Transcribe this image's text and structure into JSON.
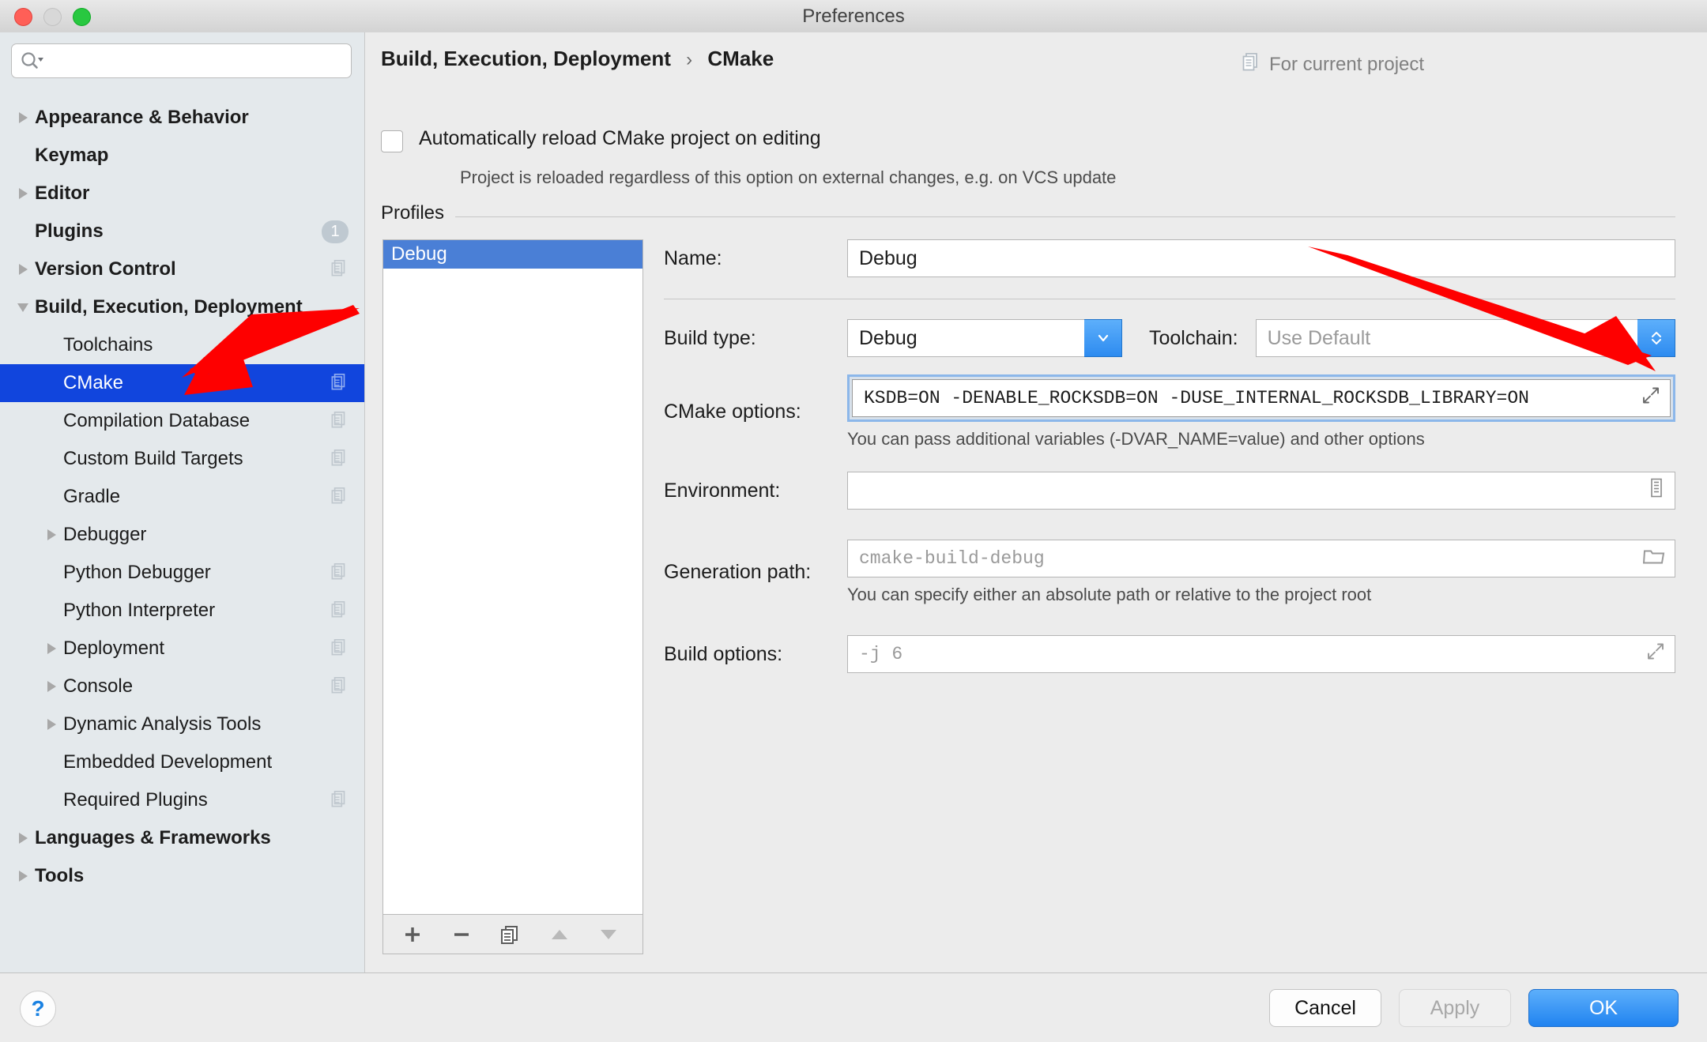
{
  "window": {
    "title": "Preferences"
  },
  "search": {
    "placeholder": "",
    "icon": "search-icon"
  },
  "sidebar": {
    "items": [
      {
        "label": "Appearance & Behavior",
        "level": 0,
        "twisty": "right",
        "bold": true,
        "badge": null,
        "project_icon": false,
        "selected": false
      },
      {
        "label": "Keymap",
        "level": 0,
        "twisty": "none",
        "bold": true,
        "badge": null,
        "project_icon": false,
        "selected": false
      },
      {
        "label": "Editor",
        "level": 0,
        "twisty": "right",
        "bold": true,
        "badge": null,
        "project_icon": false,
        "selected": false
      },
      {
        "label": "Plugins",
        "level": 0,
        "twisty": "none",
        "bold": true,
        "badge": "1",
        "project_icon": false,
        "selected": false
      },
      {
        "label": "Version Control",
        "level": 0,
        "twisty": "right",
        "bold": true,
        "badge": null,
        "project_icon": true,
        "selected": false
      },
      {
        "label": "Build, Execution, Deployment",
        "level": 0,
        "twisty": "down",
        "bold": true,
        "badge": null,
        "project_icon": false,
        "selected": false
      },
      {
        "label": "Toolchains",
        "level": 1,
        "twisty": "none",
        "bold": false,
        "badge": null,
        "project_icon": false,
        "selected": false
      },
      {
        "label": "CMake",
        "level": 1,
        "twisty": "none",
        "bold": false,
        "badge": null,
        "project_icon": true,
        "selected": true
      },
      {
        "label": "Compilation Database",
        "level": 1,
        "twisty": "none",
        "bold": false,
        "badge": null,
        "project_icon": true,
        "selected": false
      },
      {
        "label": "Custom Build Targets",
        "level": 1,
        "twisty": "none",
        "bold": false,
        "badge": null,
        "project_icon": true,
        "selected": false
      },
      {
        "label": "Gradle",
        "level": 1,
        "twisty": "none",
        "bold": false,
        "badge": null,
        "project_icon": true,
        "selected": false
      },
      {
        "label": "Debugger",
        "level": 1,
        "twisty": "right",
        "bold": false,
        "badge": null,
        "project_icon": false,
        "selected": false
      },
      {
        "label": "Python Debugger",
        "level": 1,
        "twisty": "none",
        "bold": false,
        "badge": null,
        "project_icon": true,
        "selected": false
      },
      {
        "label": "Python Interpreter",
        "level": 1,
        "twisty": "none",
        "bold": false,
        "badge": null,
        "project_icon": true,
        "selected": false
      },
      {
        "label": "Deployment",
        "level": 1,
        "twisty": "right",
        "bold": false,
        "badge": null,
        "project_icon": true,
        "selected": false
      },
      {
        "label": "Console",
        "level": 1,
        "twisty": "right",
        "bold": false,
        "badge": null,
        "project_icon": true,
        "selected": false
      },
      {
        "label": "Dynamic Analysis Tools",
        "level": 1,
        "twisty": "right",
        "bold": false,
        "badge": null,
        "project_icon": false,
        "selected": false
      },
      {
        "label": "Embedded Development",
        "level": 1,
        "twisty": "none",
        "bold": false,
        "badge": null,
        "project_icon": false,
        "selected": false
      },
      {
        "label": "Required Plugins",
        "level": 1,
        "twisty": "none",
        "bold": false,
        "badge": null,
        "project_icon": true,
        "selected": false
      },
      {
        "label": "Languages & Frameworks",
        "level": 0,
        "twisty": "right",
        "bold": true,
        "badge": null,
        "project_icon": false,
        "selected": false
      },
      {
        "label": "Tools",
        "level": 0,
        "twisty": "right",
        "bold": true,
        "badge": null,
        "project_icon": false,
        "selected": false
      }
    ]
  },
  "header": {
    "breadcrumb_parent": "Build, Execution, Deployment",
    "breadcrumb_sep": "›",
    "breadcrumb_current": "CMake",
    "for_current_project": "For current project"
  },
  "auto_reload": {
    "label": "Automatically reload CMake project on editing",
    "sub": "Project is reloaded regardless of this option on external changes, e.g. on VCS update",
    "checked": false
  },
  "profiles": {
    "group_label": "Profiles",
    "items": [
      "Debug"
    ],
    "selected_index": 0,
    "toolbar": {
      "add": "+",
      "remove": "−",
      "copy": "copy-icon",
      "up": "move-up-icon",
      "down": "move-down-icon"
    }
  },
  "form": {
    "name": {
      "label": "Name:",
      "value": "Debug"
    },
    "build_type": {
      "label": "Build type:",
      "value": "Debug"
    },
    "toolchain": {
      "label": "Toolchain:",
      "placeholder": "Use Default",
      "value": ""
    },
    "cmake_options": {
      "label": "CMake options:",
      "value": "KSDB=ON  -DENABLE_ROCKSDB=ON  -DUSE_INTERNAL_ROCKSDB_LIBRARY=ON",
      "hint": "You can pass additional variables (-DVAR_NAME=value) and other options"
    },
    "environment": {
      "label": "Environment:",
      "value": ""
    },
    "generation_path": {
      "label": "Generation path:",
      "placeholder": "cmake-build-debug",
      "hint": "You can specify either an absolute path or relative to the project root"
    },
    "build_options": {
      "label": "Build options:",
      "placeholder": "-j 6"
    }
  },
  "footer": {
    "help": "?",
    "cancel": "Cancel",
    "apply": "Apply",
    "ok": "OK"
  },
  "colors": {
    "selection_blue": "#1145dd",
    "list_selection_blue": "#4a7fd6",
    "accent_blue": "#2083f0",
    "annotation_red": "#fe0000",
    "sidebar_bg": "#e4e9ec",
    "main_bg": "#ececec"
  }
}
